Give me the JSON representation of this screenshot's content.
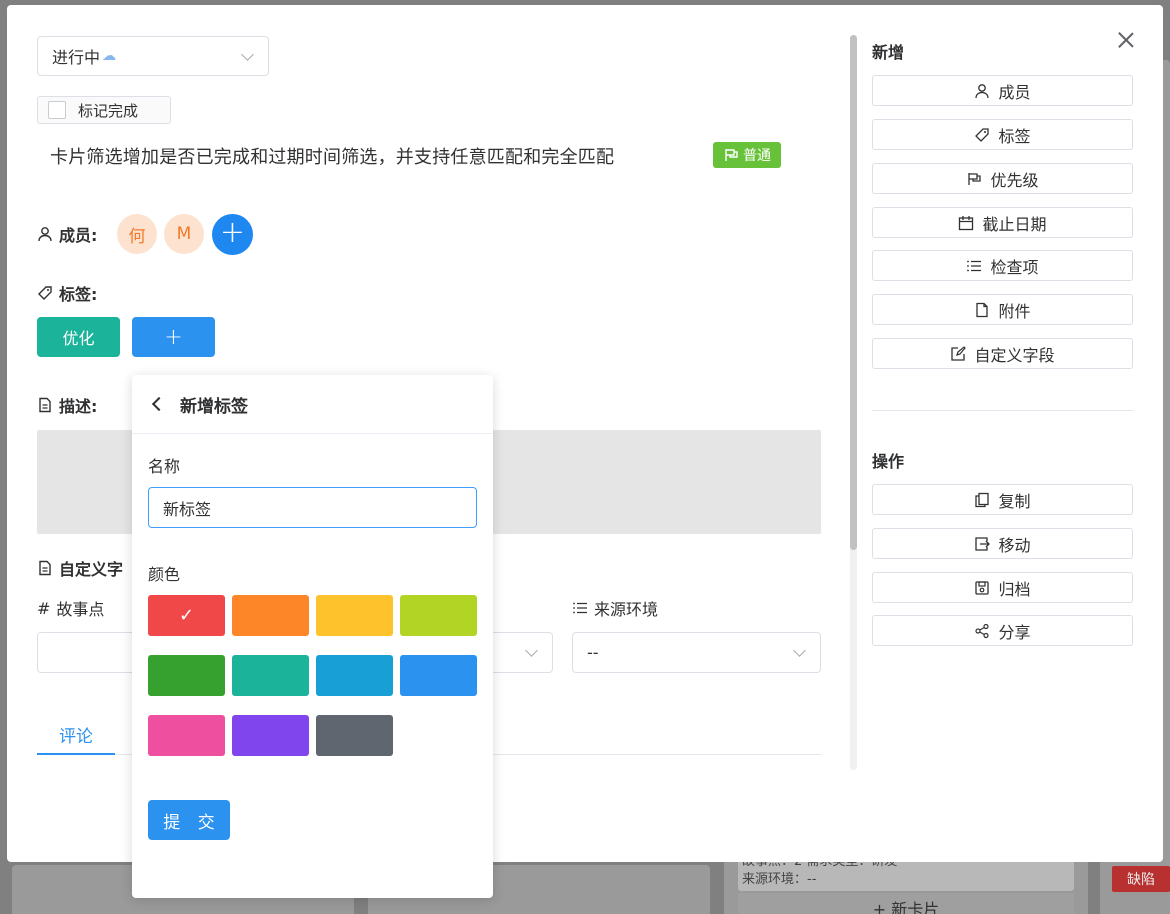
{
  "status_select": {
    "value": "进行中",
    "icon": "rain-cloud-icon"
  },
  "mark_done": {
    "label": "标记完成",
    "checked": false
  },
  "card": {
    "title": "卡片筛选增加是否已完成和过期时间筛选，并支持任意匹配和完全匹配",
    "priority": "普通"
  },
  "members": {
    "label": "成员:",
    "avatars": [
      "何",
      "M"
    ],
    "add_label": "+"
  },
  "tags": {
    "label": "标签:",
    "items": [
      "优化"
    ],
    "add_label": "+"
  },
  "description": {
    "label": "描述:"
  },
  "custom_fields": {
    "label": "自定义字",
    "story_points": {
      "label": "故事点",
      "value": ""
    },
    "source_env": {
      "label": "来源环境",
      "value": "--"
    }
  },
  "tabs": {
    "active": "评论"
  },
  "sidebar": {
    "add_heading": "新增",
    "add_buttons": [
      {
        "label": "成员",
        "icon": "user-icon"
      },
      {
        "label": "标签",
        "icon": "tag-icon"
      },
      {
        "label": "优先级",
        "icon": "flag-icon"
      },
      {
        "label": "截止日期",
        "icon": "calendar-icon"
      },
      {
        "label": "检查项",
        "icon": "list-icon"
      },
      {
        "label": "附件",
        "icon": "document-icon"
      },
      {
        "label": "自定义字段",
        "icon": "edit-icon"
      }
    ],
    "ops_heading": "操作",
    "op_buttons": [
      {
        "label": "复制",
        "icon": "copy-icon"
      },
      {
        "label": "移动",
        "icon": "move-icon"
      },
      {
        "label": "归档",
        "icon": "archive-icon"
      },
      {
        "label": "分享",
        "icon": "share-icon"
      }
    ]
  },
  "new_tag_popover": {
    "title": "新增标签",
    "name_label": "名称",
    "name_value": "新标签",
    "color_label": "颜色",
    "colors": [
      "#f04848",
      "#fd8628",
      "#fdc22c",
      "#b2d425",
      "#36a12e",
      "#1cb39b",
      "#18a0d6",
      "#2b92f0",
      "#ef4f9f",
      "#8145ee",
      "#5f6670"
    ],
    "selected_color_index": 0,
    "submit_label": "提 交"
  },
  "background": {
    "card_lines": [
      "故事点：2   需求类型：研发",
      "来源环境：--"
    ],
    "new_card_label": "+ 新卡片",
    "defect_tag": "缺陷"
  }
}
